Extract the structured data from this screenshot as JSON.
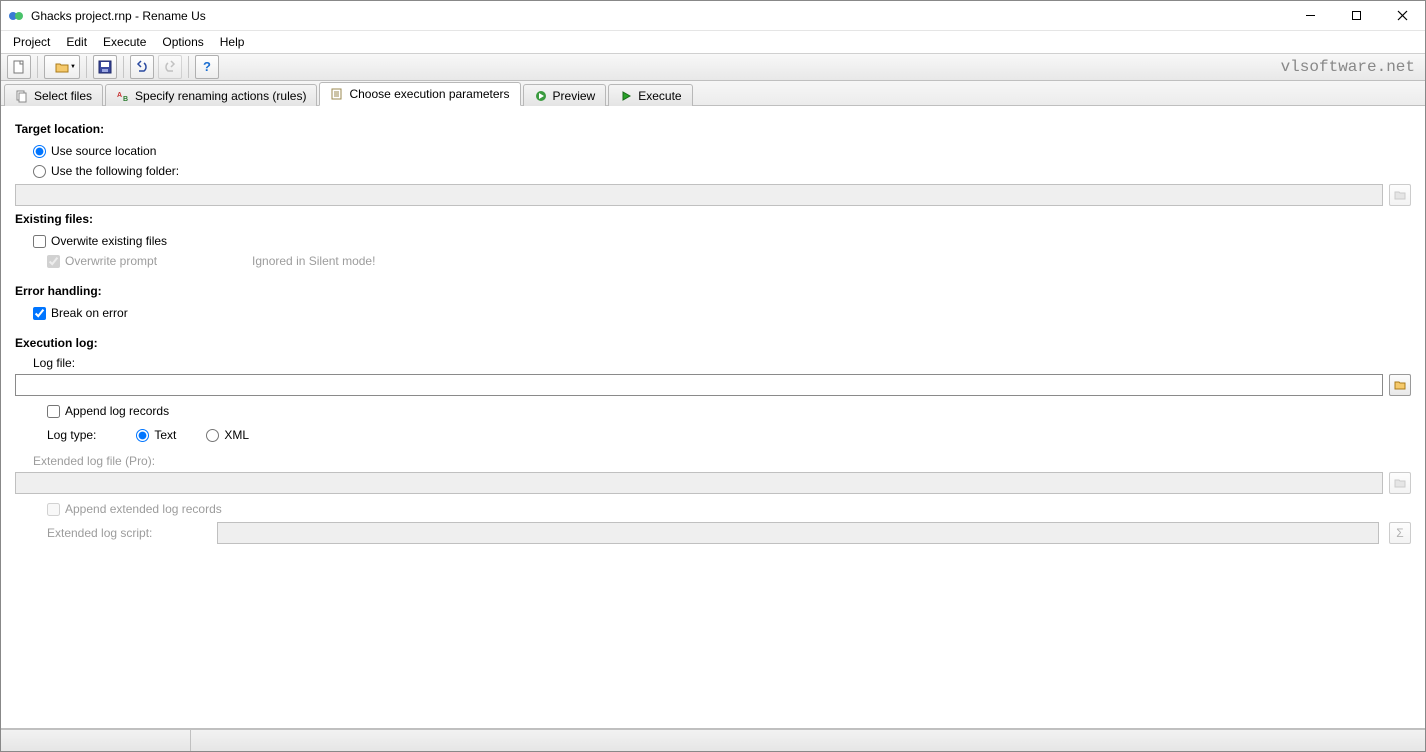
{
  "window": {
    "title": "Ghacks project.rnp - Rename Us"
  },
  "menu": {
    "items": [
      "Project",
      "Edit",
      "Execute",
      "Options",
      "Help"
    ]
  },
  "tabs": {
    "items": [
      {
        "label": "Select files"
      },
      {
        "label": "Specify renaming actions (rules)"
      },
      {
        "label": "Choose execution parameters"
      },
      {
        "label": "Preview"
      },
      {
        "label": "Execute"
      }
    ],
    "active_index": 2
  },
  "brand": "vlsoftware.net",
  "content": {
    "target_location": {
      "heading": "Target location:",
      "use_source": "Use source location",
      "use_folder": "Use the following folder:",
      "folder_value": ""
    },
    "existing_files": {
      "heading": "Existing files:",
      "overwrite": "Overwite existing files",
      "overwrite_prompt": "Overwrite prompt",
      "ignored_note": "Ignored in Silent mode!"
    },
    "error_handling": {
      "heading": "Error handling:",
      "break_on_error": "Break on error"
    },
    "execution_log": {
      "heading": "Execution log:",
      "log_file_label": "Log file:",
      "log_file_value": "",
      "append": "Append log records",
      "log_type_label": "Log type:",
      "log_type_text": "Text",
      "log_type_xml": "XML",
      "ext_log_label": "Extended log file (Pro):",
      "ext_log_value": "",
      "append_ext": "Append extended log records",
      "ext_script_label": "Extended log script:",
      "ext_script_value": ""
    }
  }
}
